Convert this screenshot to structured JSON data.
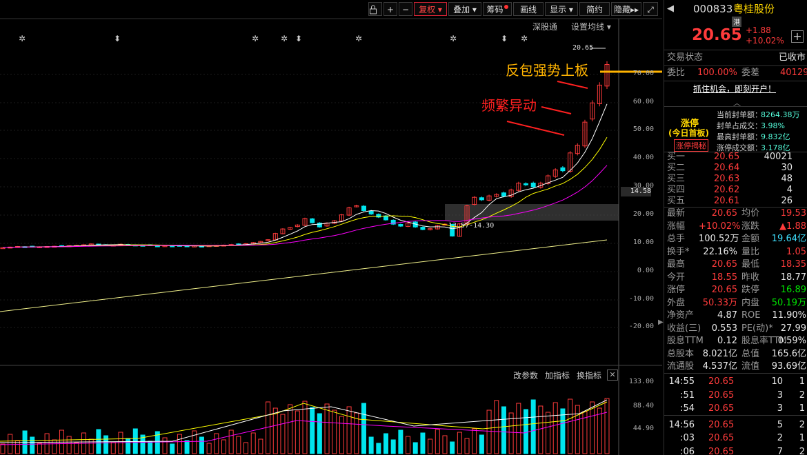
{
  "toolbar": {
    "fuquan": "复权",
    "diejia": "叠加",
    "chouma": "筹码",
    "huaxian": "画线",
    "xianshi": "显示",
    "jianyue": "简约",
    "yincang": "隐藏"
  },
  "subbar": {
    "shengutong": "深股通",
    "shezhi": "设置均线"
  },
  "annotations": {
    "top": "反包强势上板",
    "mid": "频繁异动"
  },
  "price_labels": {
    "top": "20.65",
    "zone": "13.57-14.30",
    "cursor": "14.58"
  },
  "yaxis": [
    "70.00",
    "60.00",
    "50.00",
    "40.00",
    "30.00",
    "20.00",
    "10.00",
    "0.00",
    "-10.00",
    "-20.00"
  ],
  "vol_axis": [
    "133.00",
    "88.40",
    "44.90"
  ],
  "vol_bar": {
    "gaicanshu": "改参数",
    "jiazhibiao": "加指标",
    "huanzhibiao": "换指标"
  },
  "chart_data": {
    "type": "candlestick",
    "title": "",
    "closes": [
      10.2,
      10.4,
      10.6,
      10.5,
      10.4,
      10.5,
      10.6,
      10.7,
      10.8,
      10.9,
      11.0,
      11.2,
      11.5,
      11.3,
      11.0,
      11.1,
      11.4,
      11.2,
      11.1,
      11.0,
      10.9,
      10.8,
      10.9,
      10.8,
      10.9,
      10.7,
      10.8,
      10.6,
      10.9,
      11.0,
      11.1,
      11.3,
      11.5,
      11.6,
      12.0,
      12.4,
      13.0,
      15.2,
      16.8,
      17.3,
      18.2,
      20.5,
      19.0,
      17.5,
      18.9,
      19.7,
      21.8,
      24.3,
      25.0,
      23.3,
      22.1,
      21.0,
      20.0,
      18.5,
      17.8,
      18.9,
      17.5,
      16.6,
      16.9,
      18.0,
      18.5,
      14.3,
      18.6,
      25.0,
      28.0,
      27.1,
      28.5,
      29.0,
      28.4,
      30.6,
      33.0,
      32.4,
      31.7,
      33.0,
      35.6,
      37.7,
      37.4,
      43.7,
      46.4,
      54.6,
      61.4,
      67.7,
      75.0
    ],
    "ma_lines": [
      "MA5 white",
      "MA10 yellow",
      "MA20 magenta",
      "MA250 light-yellow"
    ],
    "zone_label": "13.57-14.30",
    "last_price": 20.65
  },
  "right": {
    "code": "000833",
    "name": "粤桂股份",
    "hk_tag": "港",
    "price": "20.65",
    "chg": "+1.88",
    "pct": "+10.02%",
    "status_label": "交易状态",
    "status_value": "已收市",
    "weibi_label": "委比",
    "weibi_value": "100.00%",
    "weicha_label": "委差",
    "weicha_value": "40129",
    "promo": "抓住机会，即刻开户！",
    "zt_title": "涨停",
    "zt_sub": "(今日首板)",
    "zt_btn": "涨停揭秘",
    "zt_info": [
      {
        "k": "当前封单额：",
        "v": "8264.38万"
      },
      {
        "k": "封单占成交：",
        "v": "3.98%"
      },
      {
        "k": "最高封单额：",
        "v": "9.832亿"
      },
      {
        "k": "涨停成交额：",
        "v": "3.178亿"
      }
    ],
    "bids": [
      {
        "k": "买一",
        "p": "20.65",
        "v": "40021"
      },
      {
        "k": "买二",
        "p": "20.64",
        "v": "30"
      },
      {
        "k": "买三",
        "p": "20.63",
        "v": "48"
      },
      {
        "k": "买四",
        "p": "20.62",
        "v": "4"
      },
      {
        "k": "买五",
        "p": "20.61",
        "v": "26"
      }
    ],
    "stats": [
      {
        "k1": "最新",
        "v1": "20.65",
        "c1": "red",
        "k2": "均价",
        "v2": "19.53",
        "c2": "red"
      },
      {
        "k1": "涨幅",
        "v1": "+10.02%",
        "c1": "red",
        "k2": "涨跌",
        "v2": "▲1.88",
        "c2": "red"
      },
      {
        "k1": "总手",
        "v1": "100.52万",
        "c1": "white",
        "k2": "金额",
        "v2": "19.64亿",
        "c2": "teal"
      },
      {
        "k1": "换手*",
        "v1": "22.16%",
        "c1": "white",
        "k2": "量比",
        "v2": "1.05",
        "c2": "red"
      },
      {
        "k1": "最高",
        "v1": "20.65",
        "c1": "red",
        "k2": "最低",
        "v2": "18.35",
        "c2": "red"
      },
      {
        "k1": "今开",
        "v1": "18.55",
        "c1": "red",
        "k2": "昨收",
        "v2": "18.77",
        "c2": "white"
      },
      {
        "k1": "涨停",
        "v1": "20.65",
        "c1": "red",
        "k2": "跌停",
        "v2": "16.89",
        "c2": "green"
      },
      {
        "k1": "外盘",
        "v1": "50.33万",
        "c1": "red",
        "k2": "内盘",
        "v2": "50.19万",
        "c2": "green"
      },
      {
        "k1": "净资产",
        "v1": "4.87",
        "c1": "white",
        "k2": "ROE",
        "v2": "11.90%",
        "c2": "white"
      },
      {
        "k1": "收益(三)",
        "v1": "0.553",
        "c1": "white",
        "k2": "PE(动)*",
        "v2": "27.99",
        "c2": "white"
      },
      {
        "k1": "股息TTM",
        "v1": "0.12",
        "c1": "white",
        "k2": "股息率TTM",
        "v2": "0.59%",
        "c2": "white"
      },
      {
        "k1": "总股本",
        "v1": "8.021亿",
        "c1": "white",
        "k2": "总值",
        "v2": "165.6亿",
        "c2": "white"
      },
      {
        "k1": "流通股",
        "v1": "4.537亿",
        "c1": "white",
        "k2": "流值",
        "v2": "93.69亿",
        "c2": "white"
      }
    ],
    "ticks": [
      {
        "t": "14:55",
        "p": "20.65",
        "v": "10",
        "n": "1"
      },
      {
        "t": ":51",
        "p": "20.65",
        "v": "3",
        "n": "2"
      },
      {
        "t": ":54",
        "p": "20.65",
        "v": "3",
        "n": "1"
      },
      {
        "t": "14:56",
        "p": "20.65",
        "v": "5",
        "n": "2"
      },
      {
        "t": ":03",
        "p": "20.65",
        "v": "2",
        "n": "1"
      },
      {
        "t": ":06",
        "p": "20.65",
        "v": "7",
        "n": "2"
      }
    ]
  },
  "colors": {
    "up": "#ff3b3b",
    "down": "#00e5ee",
    "ma5": "#ffffff",
    "ma10": "#ffff00",
    "ma20": "#ff00ff",
    "ma250": "#f0f08a"
  }
}
